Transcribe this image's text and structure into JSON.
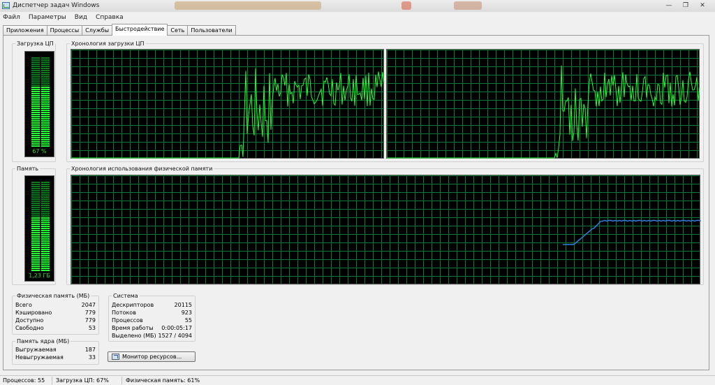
{
  "window": {
    "title": "Диспетчер задач Windows",
    "minimize_label": "—",
    "restore_label": "❐",
    "close_label": "✕"
  },
  "menu": [
    "Файл",
    "Параметры",
    "Вид",
    "Справка"
  ],
  "tabs": [
    "Приложения",
    "Процессы",
    "Службы",
    "Быстродействие",
    "Сеть",
    "Пользователи"
  ],
  "active_tab": 3,
  "cpu": {
    "meter_label": "Загрузка ЦП",
    "value": "67 %",
    "level": 0.67,
    "history_label": "Хронология загрузки ЦП"
  },
  "memory": {
    "meter_label": "Память",
    "value": "1,23 ГБ",
    "level": 0.61,
    "history_label": "Хронология использования физической памяти"
  },
  "physical_memory": {
    "title": "Физическая память (МБ)",
    "rows": [
      {
        "label": "Всего",
        "value": "2047"
      },
      {
        "label": "Кэшировано",
        "value": "779"
      },
      {
        "label": "Доступно",
        "value": "779"
      },
      {
        "label": "Свободно",
        "value": "53"
      }
    ]
  },
  "kernel_memory": {
    "title": "Память ядра (МБ)",
    "rows": [
      {
        "label": "Выгружаемая",
        "value": "187"
      },
      {
        "label": "Невыгружаемая",
        "value": "33"
      }
    ]
  },
  "system": {
    "title": "Система",
    "rows": [
      {
        "label": "Дескрипторов",
        "value": "20115"
      },
      {
        "label": "Потоков",
        "value": "923"
      },
      {
        "label": "Процессов",
        "value": "55"
      },
      {
        "label": "Время работы",
        "value": "0:00:05:17"
      },
      {
        "label": "Выделено (МБ)",
        "value": "1527 / 4094"
      }
    ]
  },
  "resource_monitor_button": "Монитор ресурсов...",
  "statusbar": {
    "processes": "Процессов: 55",
    "cpu": "Загрузка ЦП: 67%",
    "memory": "Физическая память: 61%"
  },
  "colors": {
    "graph_background": "#000000",
    "grid": "#0a7a30",
    "cpu_line": "#22ff33",
    "memory_line": "#2f7fe0",
    "meter_on": "#22ff33"
  }
}
